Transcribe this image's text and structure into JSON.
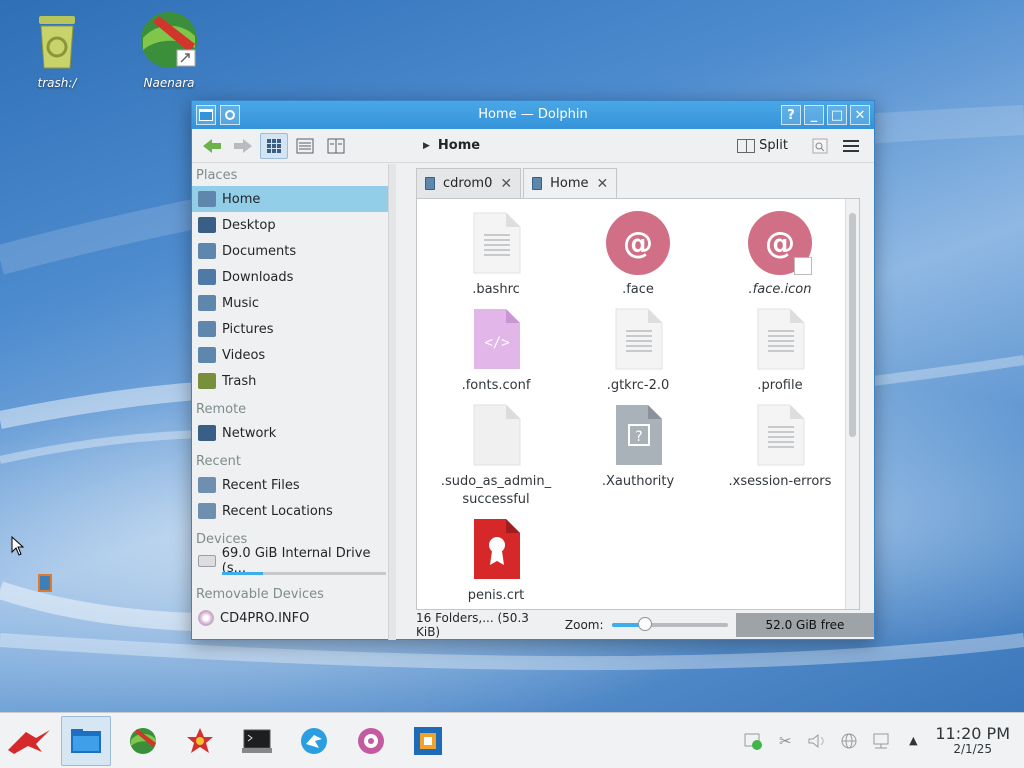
{
  "desktop": {
    "icons": [
      {
        "label": "trash:/"
      },
      {
        "label": "Naenara"
      }
    ]
  },
  "window": {
    "title": "Home — Dolphin",
    "title_buttons": {
      "help": "?",
      "minimize": "_",
      "maximize": "□",
      "close": "✕"
    }
  },
  "toolbar": {
    "breadcrumb": "Home",
    "split_label": "Split"
  },
  "places": {
    "headers": {
      "places": "Places",
      "remote": "Remote",
      "recent": "Recent",
      "devices": "Devices",
      "removable": "Removable Devices"
    },
    "items": [
      {
        "label": "Home",
        "color": "#5f86ad"
      },
      {
        "label": "Desktop",
        "color": "#3a5f86"
      },
      {
        "label": "Documents",
        "color": "#5f86ad"
      },
      {
        "label": "Downloads",
        "color": "#4f7aa6"
      },
      {
        "label": "Music",
        "color": "#5f86ad"
      },
      {
        "label": "Pictures",
        "color": "#5f86ad"
      },
      {
        "label": "Videos",
        "color": "#5f86ad"
      },
      {
        "label": "Trash",
        "color": "#7a8f3c"
      }
    ],
    "remote_items": [
      {
        "label": "Network"
      }
    ],
    "recent_items": [
      {
        "label": "Recent Files"
      },
      {
        "label": "Recent Locations"
      }
    ],
    "device_items": [
      {
        "label": "69.0 GiB Internal Drive (s...",
        "usage_fraction": 0.25
      }
    ],
    "removable_items": [
      {
        "label": "CD4PRO.INFO"
      }
    ]
  },
  "tabs": [
    {
      "label": "cdrom0",
      "close": "✕"
    },
    {
      "label": "Home",
      "close": "✕"
    }
  ],
  "files": [
    {
      "name": ".bashrc",
      "icon": "text-document-icon"
    },
    {
      "name": ".face",
      "icon": "debian-logo-icon"
    },
    {
      "name": ".face.icon",
      "icon": "debian-logo-link-icon"
    },
    {
      "name": ".fonts.conf",
      "icon": "xml-document-icon"
    },
    {
      "name": ".gtkrc-2.0",
      "icon": "text-document-icon"
    },
    {
      "name": ".profile",
      "icon": "text-document-icon"
    },
    {
      "name": ".sudo_as_admin_",
      "name2": "successful",
      "icon": "empty-document-icon"
    },
    {
      "name": ".Xauthority",
      "icon": "unknown-document-icon"
    },
    {
      "name": ".xsession-errors",
      "icon": "text-document-icon"
    },
    {
      "name": "penis.crt",
      "icon": "certificate-icon"
    }
  ],
  "status": {
    "summary": "16 Folders,... (50.3 KiB)",
    "zoom_label": "Zoom:",
    "zoom_fraction": 0.28,
    "free_space": "52.0 GiB free"
  },
  "taskbar": {
    "clock_time": "11:20 PM",
    "clock_date": "2/1/25",
    "tray_expand": "▲"
  },
  "colors": {
    "accent": "#3daee9",
    "selection": "#93cee9",
    "titlebar": "#3593d9"
  }
}
